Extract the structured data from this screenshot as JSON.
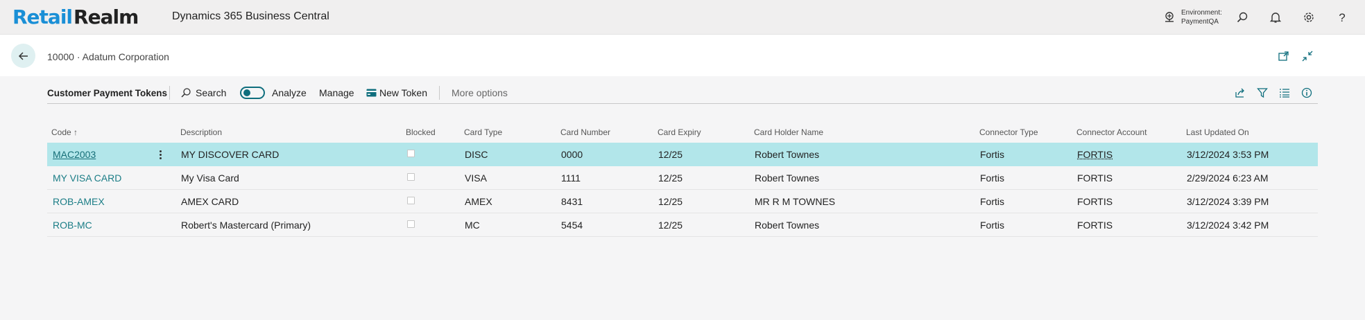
{
  "appbar": {
    "logo_retail": "Retail",
    "logo_realm": "Realm",
    "product_name": "Dynamics 365 Business Central",
    "environment_label": "Environment:",
    "environment_value": "PaymentQA",
    "icons": [
      "environment-icon",
      "search-icon",
      "bell-icon",
      "gear-icon",
      "help-icon"
    ]
  },
  "page": {
    "title": "10000 · Adatum Corporation",
    "header_icons": [
      "open-new-window-icon",
      "collapse-icon"
    ]
  },
  "actionbar": {
    "title": "Customer Payment Tokens",
    "search_label": "Search",
    "analyze_label": "Analyze",
    "manage_label": "Manage",
    "new_token_label": "New Token",
    "more_options_label": "More options",
    "right_icons": [
      "share-icon",
      "filter-icon",
      "list-view-icon",
      "info-icon"
    ]
  },
  "table": {
    "columns": [
      "Code ↑",
      "Description",
      "Blocked",
      "Card Type",
      "Card Number",
      "Card Expiry",
      "Card Holder Name",
      "Connector Type",
      "Connector Account",
      "Last Updated On"
    ],
    "rows": [
      {
        "code": "MAC2003",
        "description": "MY DISCOVER CARD",
        "blocked": false,
        "card_type": "DISC",
        "card_number": "0000",
        "card_expiry": "12/25",
        "holder": "Robert Townes",
        "connector_type": "Fortis",
        "connector_account": "FORTIS",
        "last_updated": "3/12/2024 3:53 PM",
        "selected": true
      },
      {
        "code": "MY VISA CARD",
        "description": "My Visa Card",
        "blocked": false,
        "card_type": "VISA",
        "card_number": "1111",
        "card_expiry": "12/25",
        "holder": "Robert Townes",
        "connector_type": "Fortis",
        "connector_account": "FORTIS",
        "last_updated": "2/29/2024 6:23 AM",
        "selected": false
      },
      {
        "code": "ROB-AMEX",
        "description": "AMEX CARD",
        "blocked": false,
        "card_type": "AMEX",
        "card_number": "8431",
        "card_expiry": "12/25",
        "holder": "MR R M TOWNES",
        "connector_type": "Fortis",
        "connector_account": "FORTIS",
        "last_updated": "3/12/2024 3:39 PM",
        "selected": false
      },
      {
        "code": "ROB-MC",
        "description": "Robert's Mastercard (Primary)",
        "blocked": false,
        "card_type": "MC",
        "card_number": "5454",
        "card_expiry": "12/25",
        "holder": "Robert Townes",
        "connector_type": "Fortis",
        "connector_account": "FORTIS",
        "last_updated": "3/12/2024 3:42 PM",
        "selected": false
      }
    ]
  },
  "colors": {
    "accent": "#0f6e7d",
    "selected_row": "#b2e6ea",
    "link": "#1b7d86",
    "logo_blue": "#1a8fd6"
  }
}
